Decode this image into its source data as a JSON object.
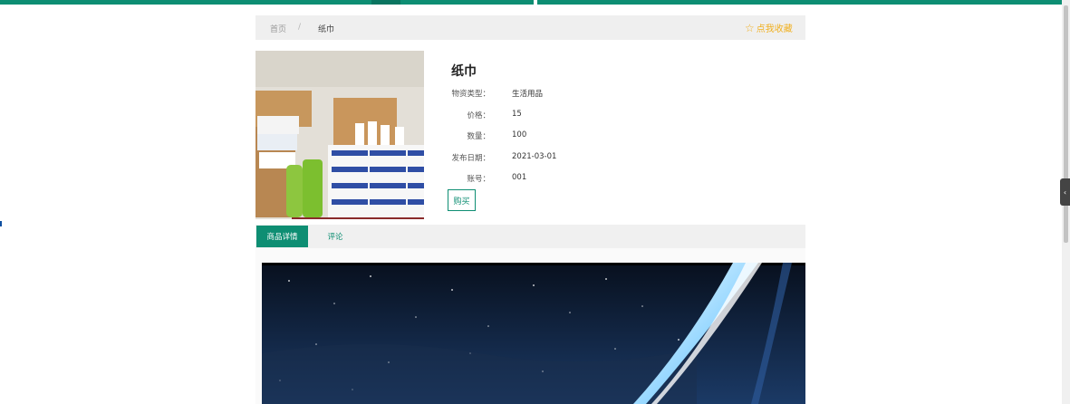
{
  "breadcrumb": {
    "home": "首页",
    "separator": "/",
    "current": "纸巾"
  },
  "favorite": {
    "label": "点我收藏",
    "icon": "star-outline-icon",
    "color": "#f0b020"
  },
  "product": {
    "title": "纸巾",
    "image_icon": "product-photo-icon",
    "fields": [
      {
        "label": "物资类型：",
        "value": "生活用品"
      },
      {
        "label": "价格：",
        "value": "15"
      },
      {
        "label": "数量：",
        "value": "100"
      },
      {
        "label": "发布日期：",
        "value": "2021-03-01"
      },
      {
        "label": "账号：",
        "value": "001"
      }
    ],
    "buy_label": "购买"
  },
  "tabs": [
    {
      "label": "商品详情",
      "active": true
    },
    {
      "label": "评论",
      "active": false
    }
  ],
  "detail": {
    "image_icon": "starry-sky-photo-icon"
  },
  "colors": {
    "accent": "#0e8e73",
    "favorite": "#f0b020"
  }
}
